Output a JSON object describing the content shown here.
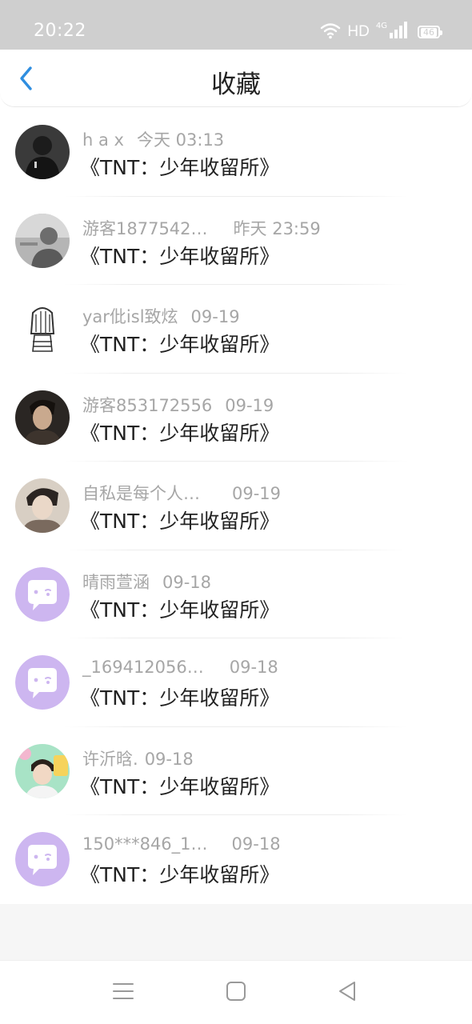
{
  "status_bar": {
    "time": "20:22",
    "network": "HD",
    "network_gen": "4G",
    "battery": "46"
  },
  "header": {
    "title": "收藏",
    "back_icon": "chevron-left-icon"
  },
  "colors": {
    "accent": "#2f8ee0",
    "muted_text": "#a6a6a6",
    "primary_text": "#222222",
    "default_avatar": "#cdb6f0"
  },
  "favorites": [
    {
      "user": "h a x",
      "time": "今天 03:13",
      "title": "《TNT：少年收留所》"
    },
    {
      "user": "游客1877542…",
      "time": "昨天 23:59",
      "title": "《TNT：少年收留所》"
    },
    {
      "user": "yar仳isl致炫",
      "time": "09-19",
      "title": "《TNT：少年收留所》"
    },
    {
      "user": "游客853172556",
      "time": "09-19",
      "title": "《TNT：少年收留所》"
    },
    {
      "user": "自私是每个人…",
      "time": "09-19",
      "title": "《TNT：少年收留所》"
    },
    {
      "user": "晴雨萱涵",
      "time": "09-18",
      "title": "《TNT：少年收留所》"
    },
    {
      "user": "_169412056…",
      "time": "09-18",
      "title": "《TNT：少年收留所》"
    },
    {
      "user": "许沂晗.",
      "time": "09-18",
      "title": "《TNT：少年收留所》"
    },
    {
      "user": "150***846_1…",
      "time": "09-18",
      "title": "《TNT：少年收留所》"
    }
  ],
  "nav_bar": {
    "menu_icon": "menu-icon",
    "home_icon": "home-square-icon",
    "back_icon": "back-triangle-icon"
  }
}
